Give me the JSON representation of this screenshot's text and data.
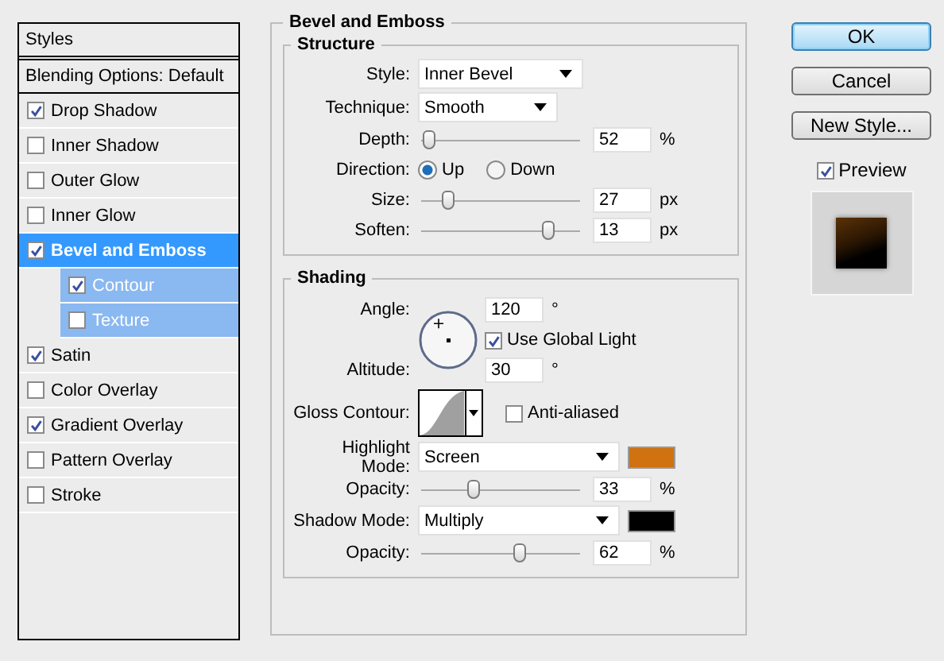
{
  "styles_panel": {
    "title": "Styles",
    "items": [
      {
        "label": "Blending Options: Default",
        "kind": "plain",
        "selected": false
      },
      {
        "label": "Drop Shadow",
        "kind": "check",
        "checked": true,
        "selected": false
      },
      {
        "label": "Inner Shadow",
        "kind": "check",
        "checked": false,
        "selected": false
      },
      {
        "label": "Outer Glow",
        "kind": "check",
        "checked": false,
        "selected": false
      },
      {
        "label": "Inner Glow",
        "kind": "check",
        "checked": false,
        "selected": false
      },
      {
        "label": "Bevel and Emboss",
        "kind": "check",
        "checked": true,
        "selected": true,
        "children": [
          {
            "label": "Contour",
            "checked": true,
            "selected": false
          },
          {
            "label": "Texture",
            "checked": false,
            "selected": false
          }
        ]
      },
      {
        "label": "Satin",
        "kind": "check",
        "checked": true,
        "selected": false
      },
      {
        "label": "Color Overlay",
        "kind": "check",
        "checked": false,
        "selected": false
      },
      {
        "label": "Gradient Overlay",
        "kind": "check",
        "checked": true,
        "selected": false
      },
      {
        "label": "Pattern Overlay",
        "kind": "check",
        "checked": false,
        "selected": false
      },
      {
        "label": "Stroke",
        "kind": "check",
        "checked": false,
        "selected": false
      }
    ]
  },
  "bevel_emboss": {
    "title": "Bevel and Emboss",
    "structure": {
      "title": "Structure",
      "style": {
        "label": "Style:",
        "value": "Inner Bevel"
      },
      "technique": {
        "label": "Technique:",
        "value": "Smooth"
      },
      "depth": {
        "label": "Depth:",
        "level": 0.05,
        "value": "52",
        "unit": "%"
      },
      "direction": {
        "label": "Direction:",
        "options": [
          {
            "label": "Up",
            "selected": true
          },
          {
            "label": "Down",
            "selected": false
          }
        ]
      },
      "size": {
        "label": "Size:",
        "level": 0.17,
        "value": "27",
        "unit": "px"
      },
      "soften": {
        "label": "Soften:",
        "level": 0.8,
        "value": "13",
        "unit": "px"
      }
    },
    "shading": {
      "title": "Shading",
      "angle": {
        "label": "Angle:",
        "value": "120",
        "unit": "°"
      },
      "use_global_light": {
        "label": "Use Global Light",
        "checked": true
      },
      "altitude": {
        "label": "Altitude:",
        "value": "30",
        "unit": "°"
      },
      "gloss_contour": {
        "label": "Gloss Contour:"
      },
      "anti_aliased": {
        "label": "Anti-aliased",
        "checked": false
      },
      "highlight_mode": {
        "label": "Highlight Mode:",
        "value": "Screen",
        "color": "#d0720f"
      },
      "highlight_opacity": {
        "label": "Opacity:",
        "level": 0.33,
        "value": "33",
        "unit": "%"
      },
      "shadow_mode": {
        "label": "Shadow Mode:",
        "value": "Multiply",
        "color": "#000000"
      },
      "shadow_opacity": {
        "label": "Opacity:",
        "level": 0.62,
        "value": "62",
        "unit": "%"
      }
    }
  },
  "buttons": [
    {
      "label": "OK",
      "kind": "default"
    },
    {
      "label": "Cancel",
      "kind": "normal"
    },
    {
      "label": "New Style...",
      "kind": "normal"
    }
  ],
  "preview": {
    "label": "Preview",
    "checked": true
  }
}
